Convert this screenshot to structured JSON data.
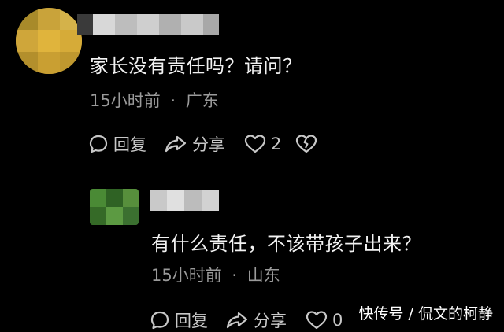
{
  "comments": [
    {
      "text": "家长没有责任吗？请问？",
      "time": "15小时前",
      "separator": "·",
      "location": "广东",
      "actions": {
        "reply_label": "回复",
        "share_label": "分享",
        "like_count": "2"
      }
    },
    {
      "text": "有什么责任，不该带孩子出来？",
      "time": "15小时前",
      "separator": "·",
      "location": "山东",
      "actions": {
        "reply_label": "回复",
        "share_label": "分享",
        "like_count": "0"
      }
    }
  ],
  "watermark": "快传号 / 侃文的柯静",
  "icons": {
    "reply": "comment-bubble-icon",
    "share": "share-arrow-icon",
    "like": "heart-outline-icon",
    "dislike": "broken-heart-icon"
  },
  "colors": {
    "background": "#000000",
    "text_primary": "#f2f2f2",
    "text_secondary": "#9a9a9a",
    "action": "#c8c8c8"
  }
}
